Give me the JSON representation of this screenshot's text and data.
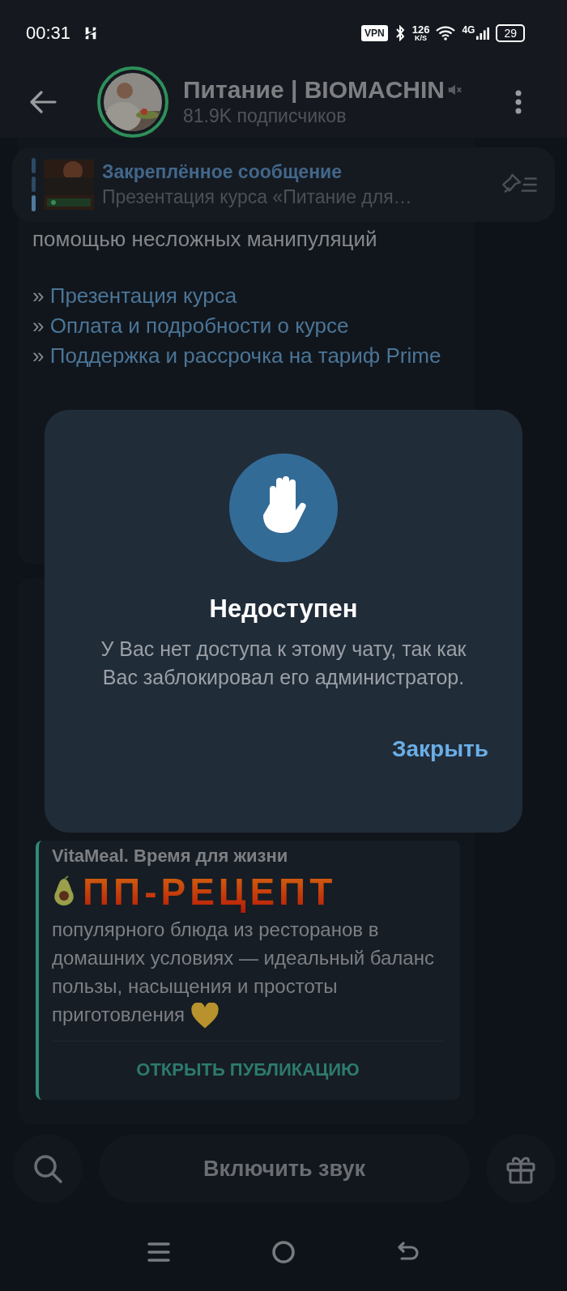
{
  "status_bar": {
    "time": "00:31",
    "vpn": "VPN",
    "speed": "126",
    "speed_unit": "K/S",
    "network": "4G",
    "battery": "29"
  },
  "header": {
    "title": "Питание | BIOMACHIN",
    "subtitle": "81.9K подписчиков",
    "muted": true
  },
  "pinned": {
    "title": "Закреплённое сообщение",
    "text": "Презентация курса «Питание для…"
  },
  "post": {
    "text": "помощью несложных манипуляций",
    "links": [
      {
        "prefix": "»",
        "label": "Презентация курса"
      },
      {
        "prefix": "»",
        "label": "Оплата и подробности о курсе"
      },
      {
        "prefix": "»",
        "label": "Поддержка и рассрочка на тариф Prime"
      }
    ]
  },
  "forward": {
    "source": "VitaMeal. Время для жизни",
    "heading": "ПП-РЕЦЕПТ",
    "text": "популярного блюда из ресторанов в домашних условиях — идеальный баланс пользы, насыщения и простоты приготовления",
    "action": "ОТКРЫТЬ ПУБЛИКАЦИЮ"
  },
  "dialog": {
    "title": "Недоступен",
    "message": "У Вас нет доступа к этому чату, так как Вас заблокировал его администратор.",
    "button": "Закрыть"
  },
  "bottom_bar": {
    "button": "Включить звук"
  }
}
